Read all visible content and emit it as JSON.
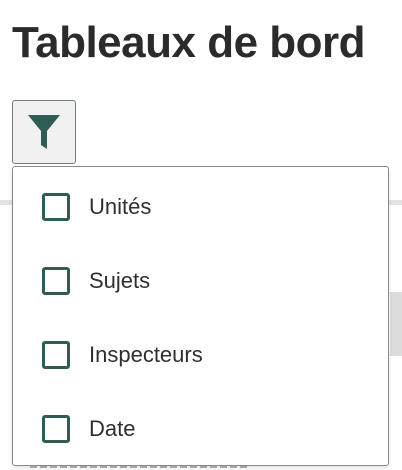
{
  "header": {
    "title": "Tableaux de bord"
  },
  "filter": {
    "icon": "funnel-icon",
    "icon_color": "#2f5d56",
    "options": [
      {
        "label": "Unités",
        "checked": false
      },
      {
        "label": "Sujets",
        "checked": false
      },
      {
        "label": "Inspecteurs",
        "checked": false
      },
      {
        "label": "Date",
        "checked": false
      }
    ]
  },
  "colors": {
    "accent": "#2f5d56",
    "text": "#2b2b2b"
  }
}
